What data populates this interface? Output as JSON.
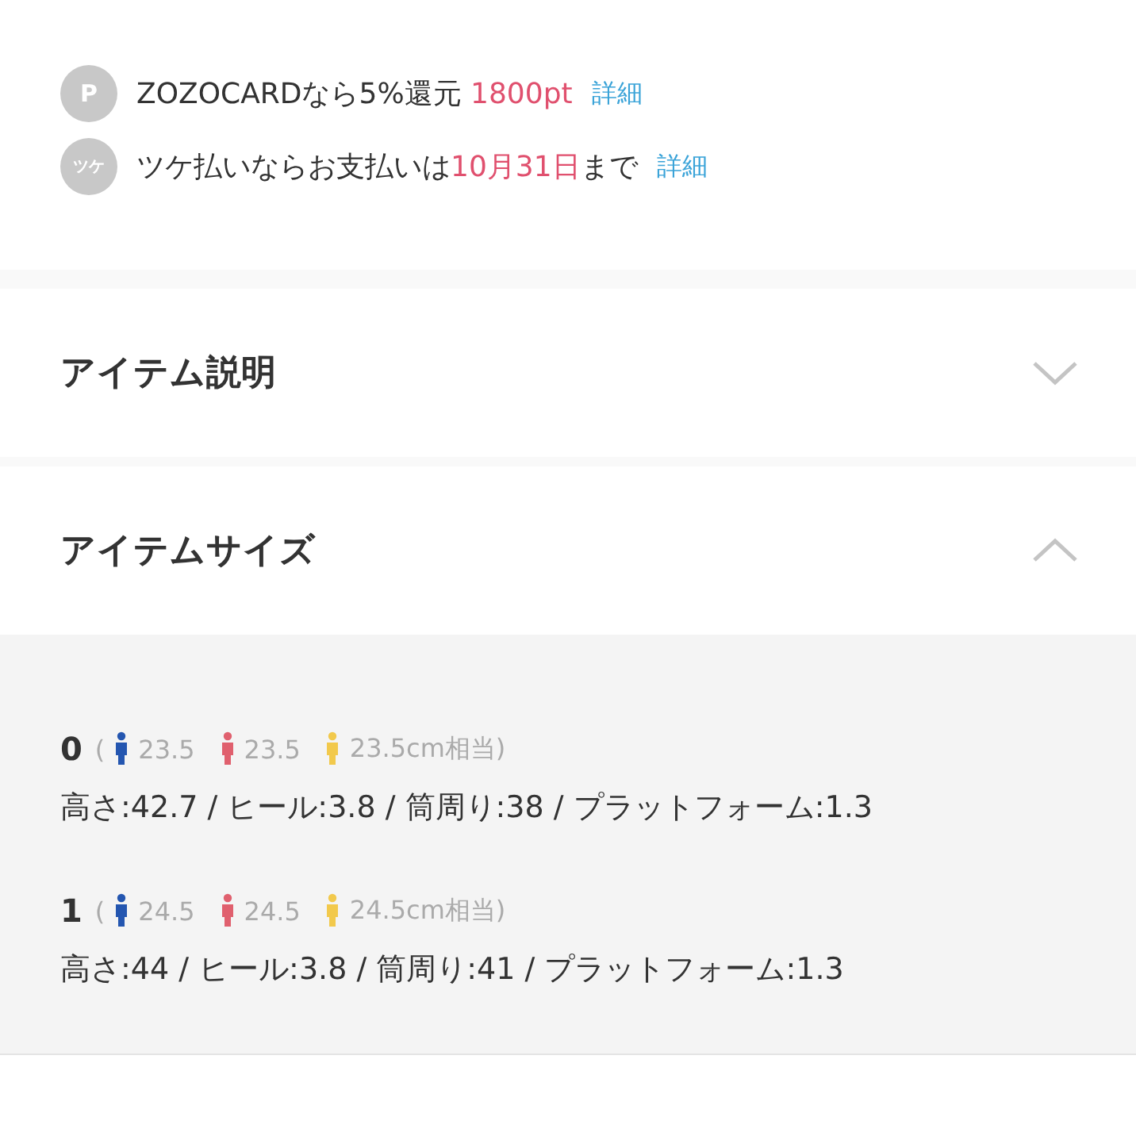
{
  "payment_lines": [
    {
      "badge": "P",
      "parts": [
        {
          "text": "ZOZOCARDなら5%還元 ",
          "highlight": false
        },
        {
          "text": "1800pt",
          "highlight": true
        }
      ],
      "link": "詳細"
    },
    {
      "badge": "ツケ",
      "parts": [
        {
          "text": "ツケ払いならお支払いは",
          "highlight": false
        },
        {
          "text": "10月31日",
          "highlight": true
        },
        {
          "text": "まで",
          "highlight": false
        }
      ],
      "link": "詳細"
    }
  ],
  "sections": [
    {
      "title": "アイテム説明",
      "expanded": false
    },
    {
      "title": "アイテムサイズ",
      "expanded": true
    }
  ],
  "sizes": [
    {
      "label": "0",
      "paren": "(",
      "fits": [
        {
          "value": "23.5",
          "color": "#2456b0"
        },
        {
          "value": "23.5",
          "color": "#e0606e"
        },
        {
          "value": "23.5cm相当)",
          "color": "#f2c94c"
        }
      ],
      "measures": "高さ:42.7 / ヒール:3.8 / 筒周り:38 / プラットフォーム:1.3"
    },
    {
      "label": "1",
      "paren": "(",
      "fits": [
        {
          "value": "24.5",
          "color": "#2456b0"
        },
        {
          "value": "24.5",
          "color": "#e0606e"
        },
        {
          "value": "24.5cm相当)",
          "color": "#f2c94c"
        }
      ],
      "measures": "高さ:44 / ヒール:3.8 / 筒周り:41 / プラットフォーム:1.3"
    }
  ]
}
